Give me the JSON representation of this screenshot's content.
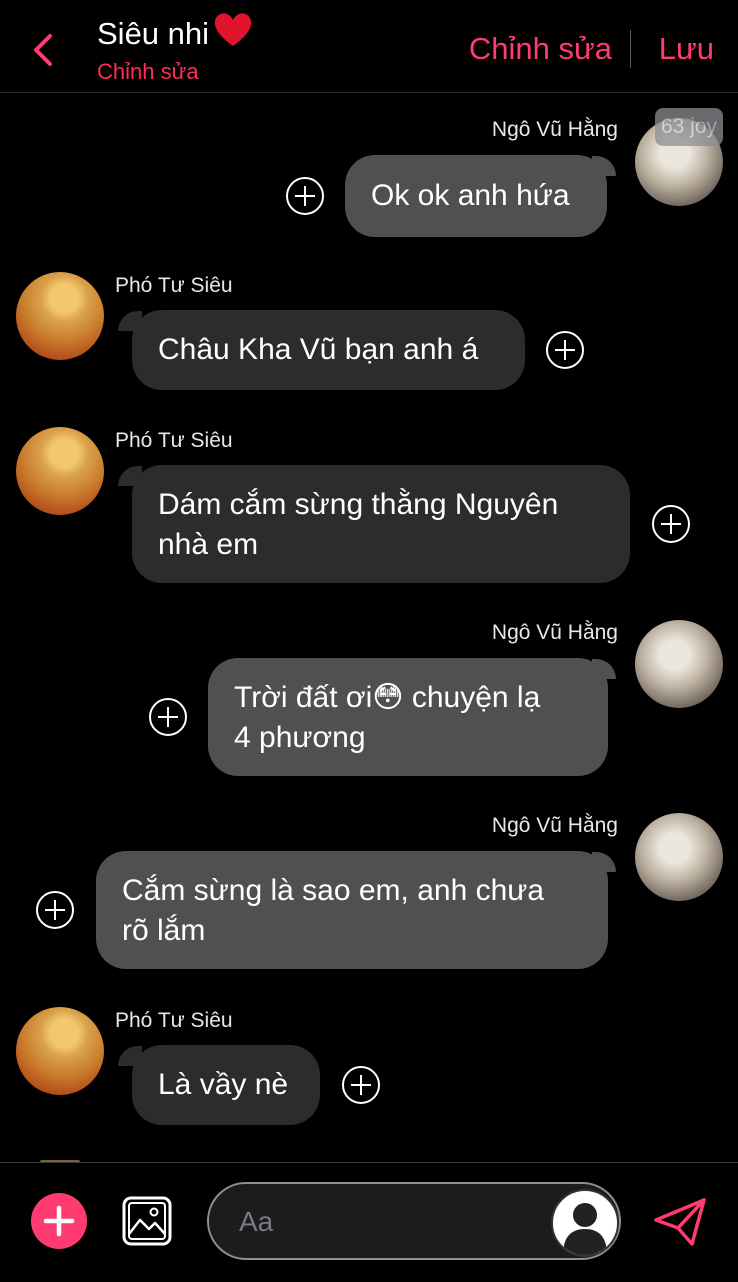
{
  "header": {
    "title": "Siêu nhi",
    "subtitle": "Chỉnh sửa",
    "edit_label": "Chỉnh sửa",
    "save_label": "Lưu",
    "accent": "#ff3b6f",
    "back_icon": "chevron-left-icon",
    "title_icon": "heart-icon"
  },
  "overlay_badge": "63 joy",
  "messages": [
    {
      "sender": "Ngô Vũ Hằng",
      "side": "right",
      "text": [
        "Ok ok anh hứa"
      ]
    },
    {
      "sender": "Phó Tư Siêu",
      "side": "left",
      "text": [
        "Châu Kha Vũ bạn anh á"
      ]
    },
    {
      "sender": "Phó Tư Siêu",
      "side": "left",
      "text": [
        "Dám cắm sừng thằng Nguyên",
        "nhà em"
      ]
    },
    {
      "sender": "Ngô Vũ Hằng",
      "side": "right",
      "text": [
        "Trời đất ơi😳 chuyện lạ",
        "4 phương"
      ]
    },
    {
      "sender": "Ngô Vũ Hằng",
      "side": "right",
      "text": [
        "Cắm sừng là sao em, anh chưa",
        "rõ lắm"
      ]
    },
    {
      "sender": "Phó Tư Siêu",
      "side": "left",
      "text": [
        "Là vầy nè"
      ]
    }
  ],
  "composer": {
    "placeholder": "Aa",
    "add_icon": "plus-icon",
    "photo_icon": "image-icon",
    "avatar_icon": "user-silhouette-icon",
    "send_icon": "send-icon"
  }
}
